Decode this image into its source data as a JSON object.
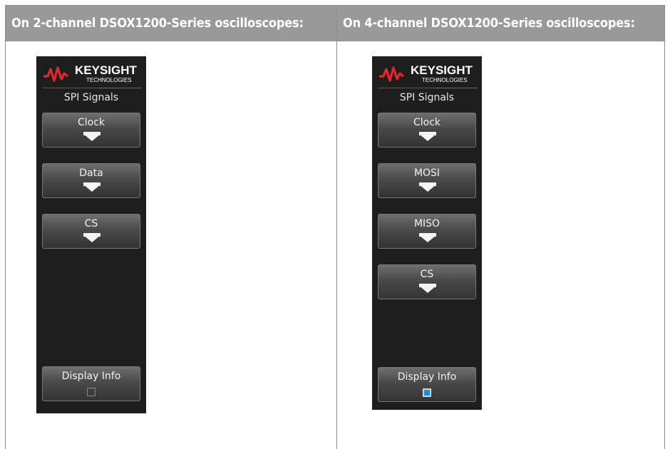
{
  "left": {
    "header": "On 2-channel DSOX1200-Series oscilloscopes:",
    "brand": {
      "name": "KEYSIGHT",
      "sub": "TECHNOLOGIES",
      "color": "#e8242c"
    },
    "panel_title": "SPI Signals",
    "buttons": [
      {
        "label": "Clock"
      },
      {
        "label": "Data"
      },
      {
        "label": "CS"
      }
    ],
    "display_info": {
      "label": "Display Info",
      "checked": false
    }
  },
  "right": {
    "header": "On 4-channel DSOX1200-Series oscilloscopes:",
    "brand": {
      "name": "KEYSIGHT",
      "sub": "TECHNOLOGIES",
      "color": "#e8242c"
    },
    "panel_title": "SPI Signals",
    "buttons": [
      {
        "label": "Clock"
      },
      {
        "label": "MOSI"
      },
      {
        "label": "MISO"
      },
      {
        "label": "CS"
      }
    ],
    "display_info": {
      "label": "Display Info",
      "checked": true
    }
  }
}
